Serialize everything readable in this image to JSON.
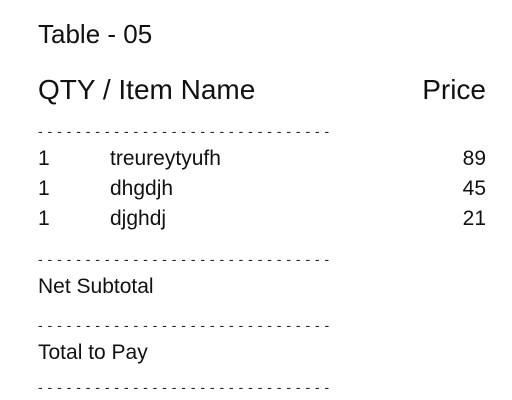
{
  "title": "Table - 05",
  "header": {
    "left": "QTY / Item Name",
    "right": "Price"
  },
  "separator": "- - - - - - - - - - - - - - - - - - - - - - - - - - - - - - -",
  "items": [
    {
      "qty": "1",
      "name": "treureytyufh",
      "price": "89"
    },
    {
      "qty": "1",
      "name": "dhgdjh",
      "price": "45"
    },
    {
      "qty": "1",
      "name": "djghdj",
      "price": "21"
    }
  ],
  "net_subtotal_label": "Net Subtotal",
  "total_label": "Total to Pay"
}
